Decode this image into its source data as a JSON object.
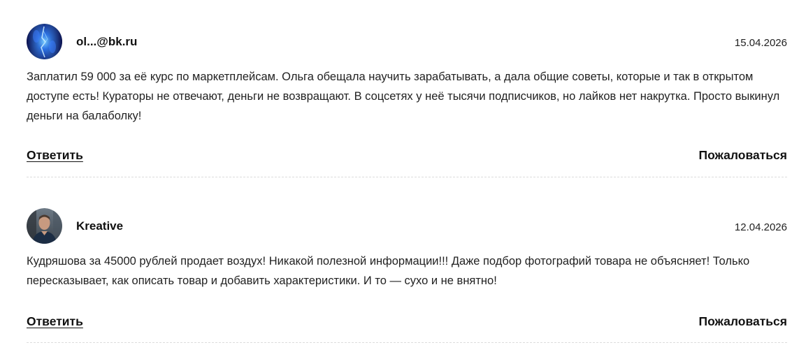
{
  "comments": [
    {
      "author": "ol...@bk.ru",
      "date": "15.04.2026",
      "text": "Заплатил 59 000 за её курс по маркетплейсам. Ольга обещала научить зарабатывать, а дала общие советы, которые и так в открытом доступе есть! Кураторы не отвечают, деньги не возвращают. В соцсетях у неё тысячи подписчиков, но лайков нет накрутка. Просто выкинул деньги на балаболку!",
      "reply_label": "Ответить",
      "complain_label": "Пожаловаться",
      "avatar_icon": "blue-abstract-avatar"
    },
    {
      "author": "Kreative",
      "date": "12.04.2026",
      "text": "Кудряшова за 45000 рублей продает воздух! Никакой полезной информации!!! Даже подбор фотографий товара не объясняет! Только пересказывает, как описать товар и добавить характеристики. И то — сухо и не внятно!",
      "reply_label": "Ответить",
      "complain_label": "Пожаловаться",
      "avatar_icon": "man-photo-avatar"
    }
  ],
  "colors": {
    "text": "#222222",
    "divider": "#dcdcdc",
    "background": "#ffffff"
  }
}
